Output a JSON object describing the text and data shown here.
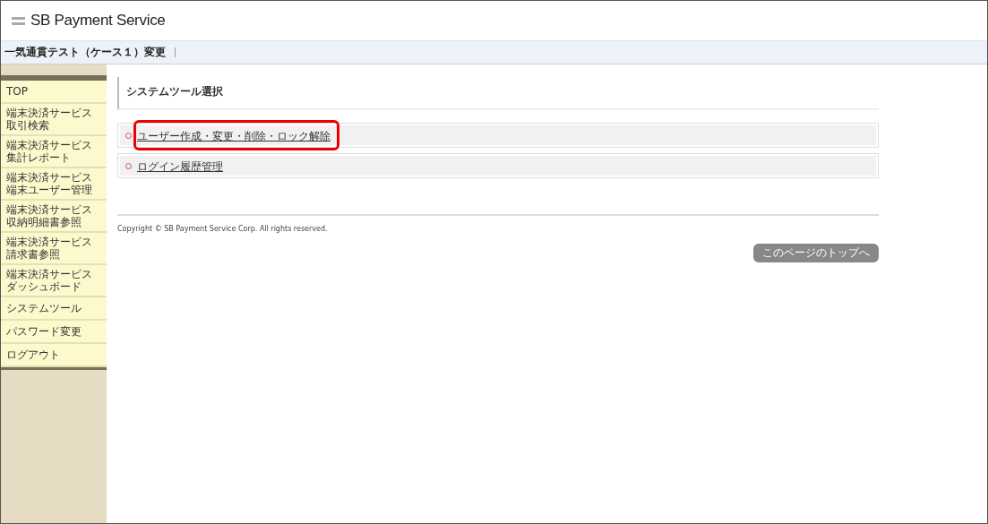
{
  "header": {
    "logo": "SB Payment Service"
  },
  "title_bar": {
    "title": "一気通貫テスト（ケース１）変更"
  },
  "sidebar": {
    "items": [
      {
        "lines": [
          "TOP"
        ]
      },
      {
        "lines": [
          "端末決済サービス",
          "取引検索"
        ]
      },
      {
        "lines": [
          "端末決済サービス",
          "集計レポート"
        ]
      },
      {
        "lines": [
          "端末決済サービス",
          "端末ユーザー管理"
        ]
      },
      {
        "lines": [
          "端末決済サービス",
          "収納明細書参照"
        ]
      },
      {
        "lines": [
          "端末決済サービス",
          "請求書参照"
        ]
      },
      {
        "lines": [
          "端末決済サービス",
          "ダッシュボード"
        ]
      },
      {
        "lines": [
          "システムツール"
        ]
      },
      {
        "lines": [
          "パスワード変更"
        ]
      },
      {
        "lines": [
          "ログアウト"
        ]
      }
    ]
  },
  "main": {
    "heading": "システムツール選択",
    "links": [
      {
        "label": "ユーザー作成・変更・削除・ロック解除",
        "highlighted": true
      },
      {
        "label": "ログイン履歴管理",
        "highlighted": false
      }
    ],
    "copyright": "Copyright © SB Payment Service Corp. All rights reserved.",
    "page_top_button": "このページのトップへ"
  }
}
